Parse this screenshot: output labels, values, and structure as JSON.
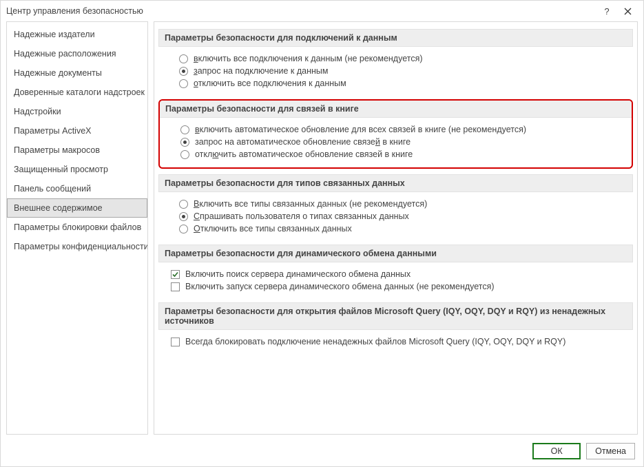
{
  "window": {
    "title": "Центр управления безопасностью"
  },
  "sidebar": {
    "items": [
      {
        "label": "Надежные издатели"
      },
      {
        "label": "Надежные расположения"
      },
      {
        "label": "Надежные документы"
      },
      {
        "label": "Доверенные каталоги надстроек"
      },
      {
        "label": "Надстройки"
      },
      {
        "label": "Параметры ActiveX"
      },
      {
        "label": "Параметры макросов"
      },
      {
        "label": "Защищенный просмотр"
      },
      {
        "label": "Панель сообщений"
      },
      {
        "label": "Внешнее содержимое"
      },
      {
        "label": "Параметры блокировки файлов"
      },
      {
        "label": "Параметры конфиденциальности"
      }
    ],
    "selected_index": 9
  },
  "sections": {
    "data_conn": {
      "title": "Параметры безопасности для подключений к данным",
      "opts": [
        "включить все подключения к данным (не рекомендуется)",
        "запрос на подключение к данным",
        "отключить все подключения к данным"
      ],
      "u": [
        "в",
        "з",
        "о"
      ],
      "selected": 1
    },
    "workbook_links": {
      "title": "Параметры безопасности для связей в книге",
      "opts": [
        "включить автоматическое обновление для всех связей в книге (не рекомендуется)",
        "запрос на автоматическое обновление связей в книге",
        "отключить автоматическое обновление связей в книге"
      ],
      "u": [
        "в",
        "й",
        "ю"
      ],
      "selected": 1
    },
    "linked_types": {
      "title": "Параметры безопасности для типов связанных данных",
      "opts": [
        "Включить все типы связанных данных (не рекомендуется)",
        "Спрашивать пользователя о типах связанных данных",
        "Отключить все типы связанных данных"
      ],
      "u": [
        "В",
        "С",
        "О"
      ],
      "selected": 1
    },
    "dde": {
      "title": "Параметры безопасности для динамического обмена данными",
      "checks": [
        {
          "label": "Включить поиск сервера динамического обмена данных",
          "checked": true,
          "u": "д"
        },
        {
          "label": "Включить запуск сервера динамического обмена данных (не рекомендуется)",
          "checked": false,
          "u": "д"
        }
      ]
    },
    "msquery": {
      "title": "Параметры безопасности для открытия файлов Microsoft Query (IQY, OQY, DQY и RQY) из ненадежных источников",
      "check": {
        "label": "Всегда блокировать подключение ненадежных файлов Microsoft Query (IQY, OQY, DQY и RQY)",
        "checked": false
      }
    }
  },
  "footer": {
    "ok": "ОК",
    "cancel": "Отмена"
  }
}
